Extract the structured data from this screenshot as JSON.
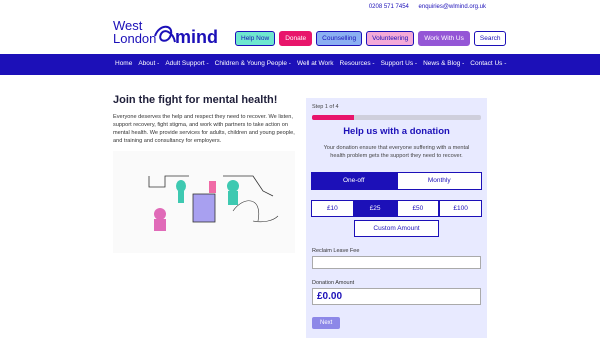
{
  "brand": {
    "line1": "West",
    "line2": "London",
    "mind": "mind"
  },
  "contact": {
    "phone": "0208 571 7454",
    "email": "enquiries@wlmind.org.uk"
  },
  "quick_links": [
    "Help Now",
    "Donate",
    "Counselling",
    "Volunteering",
    "Work With Us",
    "Search"
  ],
  "nav": [
    "Home",
    "About -",
    "Adult Support -",
    "Children & Young People -",
    "Well at Work",
    "Resources -",
    "Support Us -",
    "News & Blog -",
    "Contact Us -"
  ],
  "intro": {
    "title": "Join the fight for mental health!",
    "body": "Everyone deserves the help and respect they need to recover. We listen, support recovery, fight stigma, and work with partners to take action on mental health. We provide services for adults, children and young people, and training and consultancy for employers."
  },
  "donation": {
    "step": "Step 1 of 4",
    "progress": 0.25,
    "title": "Help us with a donation",
    "description": "Your donation ensure that everyone suffering with a mental health problem gets the support they need to recover.",
    "frequency": [
      "One-off",
      "Monthly"
    ],
    "amounts": [
      "£10",
      "£25",
      "£50",
      "£100"
    ],
    "custom_label": "Custom Amount",
    "reclaim_label": "Reclaim Leave Fee",
    "amount_label": "Donation Amount",
    "amount_value": "£0.00",
    "next_label": "Next"
  },
  "colors": {
    "brand": "#1c10b8",
    "accent": "#e8156b"
  }
}
